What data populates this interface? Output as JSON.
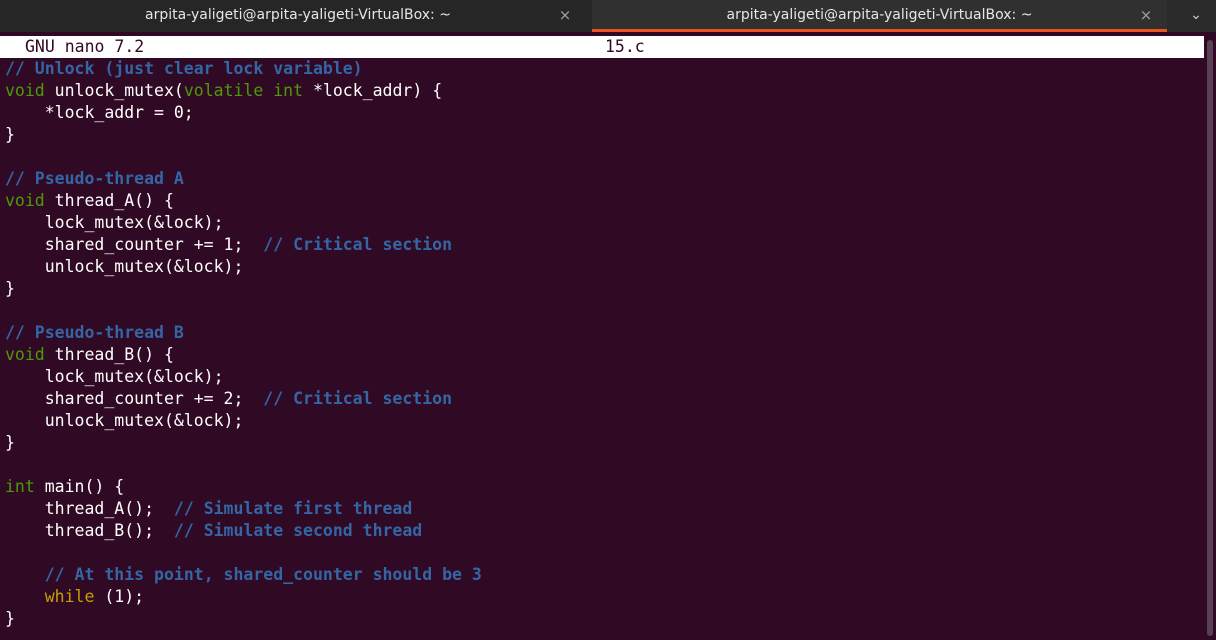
{
  "tabs": [
    {
      "title": "arpita-yaligeti@arpita-yaligeti-VirtualBox: ~",
      "close_icon": "×"
    },
    {
      "title": "arpita-yaligeti@arpita-yaligeti-VirtualBox: ~",
      "close_icon": "×"
    }
  ],
  "menu_icon": "⌄",
  "colors": {
    "background": "#300a24",
    "comment": "#3465a4",
    "type": "#4e9a06",
    "keyword": "#c4a000",
    "text": "#ffffff",
    "accent": "#e95420"
  },
  "nano": {
    "version": "GNU nano 7.2",
    "filename": "15.c"
  },
  "code_lines": [
    [
      {
        "t": "// Unlock (just clear lock variable)",
        "c": "comment"
      }
    ],
    [
      {
        "t": "void",
        "c": "type"
      },
      {
        "t": " unlock_mutex(",
        "c": "plain"
      },
      {
        "t": "volatile",
        "c": "type"
      },
      {
        "t": " ",
        "c": "plain"
      },
      {
        "t": "int",
        "c": "type"
      },
      {
        "t": " *lock_addr) {",
        "c": "plain"
      }
    ],
    [
      {
        "t": "    *lock_addr = 0;",
        "c": "plain"
      }
    ],
    [
      {
        "t": "}",
        "c": "plain"
      }
    ],
    [],
    [
      {
        "t": "// Pseudo-thread A",
        "c": "comment"
      }
    ],
    [
      {
        "t": "void",
        "c": "type"
      },
      {
        "t": " thread_A() {",
        "c": "plain"
      }
    ],
    [
      {
        "t": "    lock_mutex(&lock);",
        "c": "plain"
      }
    ],
    [
      {
        "t": "    shared_counter += 1;  ",
        "c": "plain"
      },
      {
        "t": "// Critical section",
        "c": "comment"
      }
    ],
    [
      {
        "t": "    unlock_mutex(&lock);",
        "c": "plain"
      }
    ],
    [
      {
        "t": "}",
        "c": "plain"
      }
    ],
    [],
    [
      {
        "t": "// Pseudo-thread B",
        "c": "comment"
      }
    ],
    [
      {
        "t": "void",
        "c": "type"
      },
      {
        "t": " thread_B() {",
        "c": "plain"
      }
    ],
    [
      {
        "t": "    lock_mutex(&lock);",
        "c": "plain"
      }
    ],
    [
      {
        "t": "    shared_counter += 2;  ",
        "c": "plain"
      },
      {
        "t": "// Critical section",
        "c": "comment"
      }
    ],
    [
      {
        "t": "    unlock_mutex(&lock);",
        "c": "plain"
      }
    ],
    [
      {
        "t": "}",
        "c": "plain"
      }
    ],
    [],
    [
      {
        "t": "int",
        "c": "type"
      },
      {
        "t": " main() {",
        "c": "plain"
      }
    ],
    [
      {
        "t": "    thread_A();  ",
        "c": "plain"
      },
      {
        "t": "// Simulate first thread",
        "c": "comment"
      }
    ],
    [
      {
        "t": "    thread_B();  ",
        "c": "plain"
      },
      {
        "t": "// Simulate second thread",
        "c": "comment"
      }
    ],
    [],
    [
      {
        "t": "    ",
        "c": "plain"
      },
      {
        "t": "// At this point, shared_counter should be 3",
        "c": "comment"
      }
    ],
    [
      {
        "t": "    ",
        "c": "plain"
      },
      {
        "t": "while",
        "c": "keyword"
      },
      {
        "t": " (1);",
        "c": "plain"
      }
    ],
    [
      {
        "t": "}",
        "c": "plain"
      }
    ]
  ]
}
